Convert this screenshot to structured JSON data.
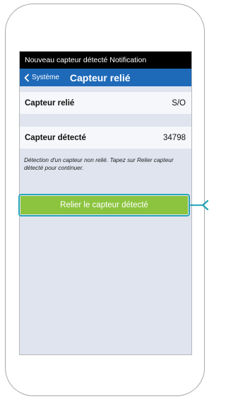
{
  "notification": {
    "title": "Nouveau capteur détecté Notification"
  },
  "nav": {
    "back_label": "Système",
    "title": "Capteur relié"
  },
  "rows": [
    {
      "label": "Capteur relié",
      "value": "S/O"
    },
    {
      "label": "Capteur détecté",
      "value": "34798"
    }
  ],
  "info_text": "Détection d'un capteur non relié. Tapez sur Relier capteur détecté pour continuer.",
  "action_button": {
    "label": "Relier le capteur détecté"
  },
  "colors": {
    "notification_bg": "#000000",
    "nav_bg": "#1e6ab9",
    "button_bg": "#8cc43f",
    "highlight": "#2aa7b8",
    "screen_bg": "#dfe4ef"
  }
}
